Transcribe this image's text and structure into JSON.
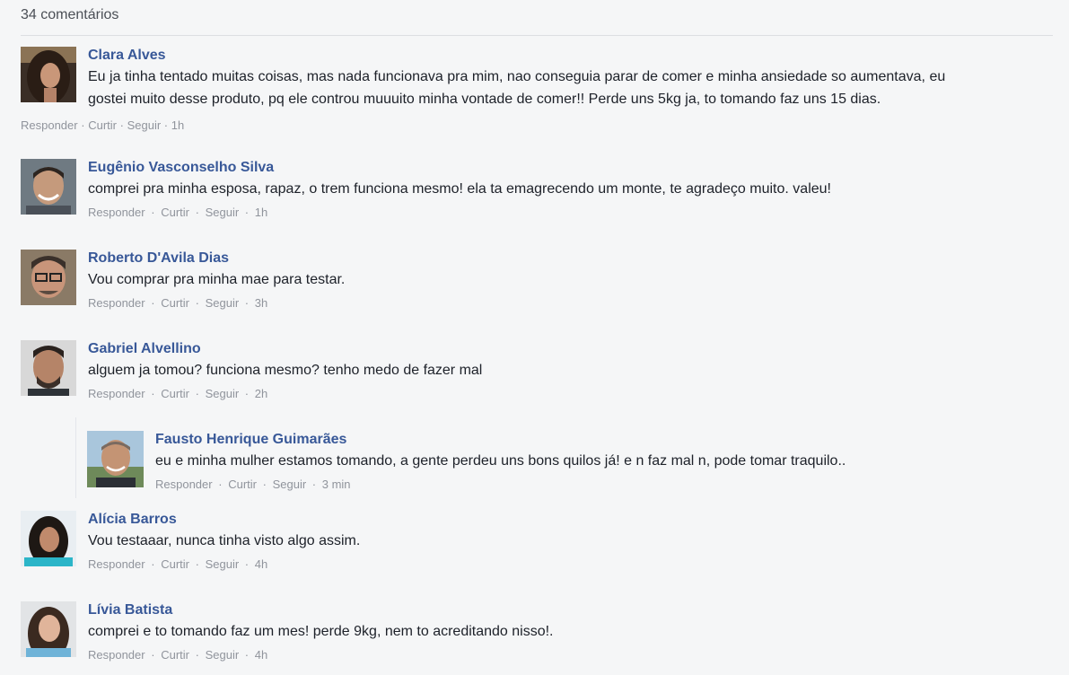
{
  "header": {
    "count_label": "34 comentários"
  },
  "action_labels": {
    "reply": "Responder",
    "like": "Curtir",
    "follow": "Seguir",
    "separator": "·"
  },
  "comments": [
    {
      "author": "Clara Alves",
      "text_line1": "Eu ja tinha tentado muitas coisas, mas nada funcionava pra mim, nao conseguia parar de comer e minha ansiedade so aumentava, eu",
      "text_line2": "gostei muito desse produto, pq ele controu muuuito minha vontade de comer!! Perde uns 5kg ja, to tomando faz uns 15 dias.",
      "time": "1h"
    },
    {
      "author": "Eugênio Vasconselho Silva",
      "text_line1": "comprei pra minha esposa, rapaz, o trem funciona mesmo! ela ta emagrecendo um monte, te agradeço muito. valeu!",
      "time": "1h"
    },
    {
      "author": "Roberto D'Avila Dias",
      "text_line1": "Vou comprar pra minha mae para testar.",
      "time": "3h"
    },
    {
      "author": "Gabriel Alvellino",
      "text_line1": "alguem ja tomou? funciona mesmo? tenho medo de fazer mal",
      "time": "2h"
    },
    {
      "author": "Fausto Henrique Guimarães",
      "text_line1": "eu e minha mulher estamos tomando, a gente perdeu uns bons quilos já! e n faz mal n, pode tomar traquilo..",
      "time": "3 min"
    },
    {
      "author": "Alícia Barros",
      "text_line1": "Vou testaaar, nunca tinha visto algo assim.",
      "time": "4h"
    },
    {
      "author": "Lívia Batista",
      "text_line1": "comprei e to tomando faz um mes! perde 9kg, nem to acreditando nisso!.",
      "time": "4h"
    }
  ]
}
